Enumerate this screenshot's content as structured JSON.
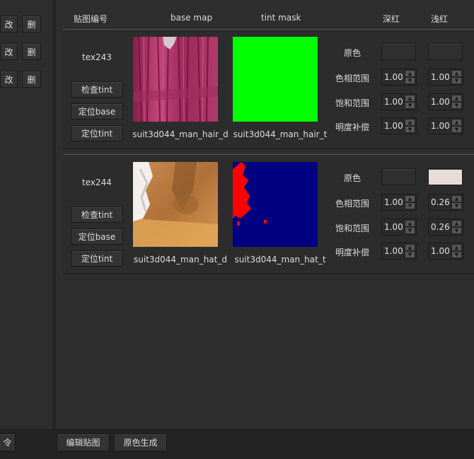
{
  "left_panel": {
    "rows": [
      {
        "edit": "改",
        "delete": "删"
      },
      {
        "edit": "改",
        "delete": "删"
      },
      {
        "edit": "改",
        "delete": "删"
      }
    ]
  },
  "headers": {
    "tex_id": "贴图编号",
    "base_map": "base map",
    "tint_mask": "tint mask",
    "deep_red": "深红",
    "light_red": "浅红"
  },
  "entries": [
    {
      "tex_id": "tex243",
      "buttons": {
        "check_tint": "检查tint",
        "locate_base": "定位base",
        "locate_tint": "定位tint"
      },
      "base_caption": "suit3d044_man_hair_d",
      "tint_caption": "suit3d044_man_hair_t",
      "params": {
        "original": "原色",
        "hue_range": "色相范围",
        "sat_range": "饱和范围",
        "bright_comp": "明度补偿"
      },
      "deep": {
        "color": "#2f2f2f",
        "hue": "1.00",
        "sat": "1.00",
        "bright": "1.00"
      },
      "light": {
        "color": "#2f2f2f",
        "hue": "1.00",
        "sat": "1.00",
        "bright": "1.00"
      }
    },
    {
      "tex_id": "tex244",
      "buttons": {
        "check_tint": "检查tint",
        "locate_base": "定位base",
        "locate_tint": "定位tint"
      },
      "base_caption": "suit3d044_man_hat_d",
      "tint_caption": "suit3d044_man_hat_t",
      "params": {
        "original": "原色",
        "hue_range": "色相范围",
        "sat_range": "饱和范围",
        "bright_comp": "明度补偿"
      },
      "deep": {
        "color": "#2f2f2f",
        "hue": "1.00",
        "sat": "1.00",
        "bright": "1.00"
      },
      "light": {
        "color": "#e9dcd8",
        "hue": "0.26",
        "sat": "0.26",
        "bright": "1.00"
      }
    }
  ],
  "bottom_bar": {
    "left_cut": "令",
    "edit_textures": "编辑贴图",
    "generate_original": "原色生成"
  },
  "colors": {
    "background": "#2a2a2a",
    "tint_green": "#00ff00",
    "tint_navy": "#000080",
    "tint_red": "#ff0000"
  }
}
